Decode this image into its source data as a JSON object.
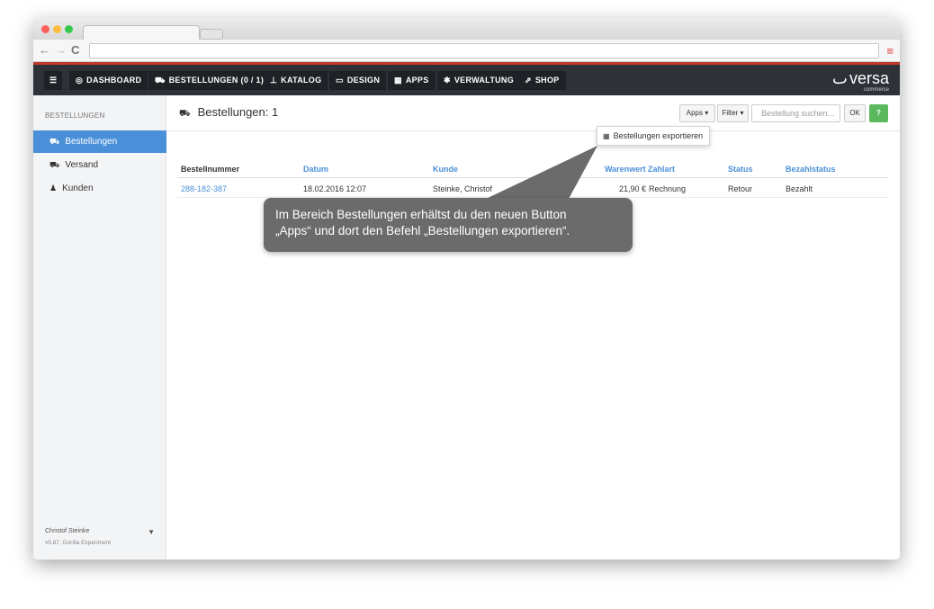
{
  "nav": {
    "items": [
      {
        "icon": "dashboard-icon",
        "label": "DASHBOARD"
      },
      {
        "icon": "cart-icon",
        "label": "BESTELLUNGEN (0 / 1)"
      },
      {
        "icon": "sitemap-icon",
        "label": "KATALOG"
      },
      {
        "icon": "monitor-icon",
        "label": "DESIGN"
      },
      {
        "icon": "grid-icon",
        "label": "APPS"
      },
      {
        "icon": "gear-icon",
        "label": "VERWALTUNG"
      },
      {
        "icon": "external-link-icon",
        "label": "SHOP"
      }
    ],
    "logo": {
      "text": "versa",
      "sub": "commerce"
    }
  },
  "sidebar": {
    "title": "BESTELLUNGEN",
    "items": [
      {
        "icon": "cart-icon",
        "label": "Bestellungen",
        "active": true
      },
      {
        "icon": "truck-icon",
        "label": "Versand",
        "active": false
      },
      {
        "icon": "user-icon",
        "label": "Kunden",
        "active": false
      }
    ],
    "user": "Christof Steinke",
    "version": "v5.87, Gorilla Experiment"
  },
  "main": {
    "title": "Bestellungen: 1",
    "apps_button": "Apps ▾",
    "filter_button": "Filter ▾",
    "search_placeholder": "Bestellung suchen...",
    "ok_button": "OK",
    "help_button": "?",
    "dropdown_item": "Bestellungen exportieren",
    "columns": [
      "Bestellnummer",
      "Datum",
      "Kunde",
      "Warenwert",
      "Zahlart",
      "Status",
      "Bezahlstatus"
    ],
    "rows": [
      [
        "288-182-387",
        "18.02.2016 12:07",
        "Steinke, Christof",
        "21,90 €",
        "Rechnung",
        "Retour",
        "Bezahlt"
      ]
    ]
  },
  "callout": {
    "line1": "Im Bereich Bestellungen erhältst du den neuen Button",
    "line2": "„Apps“ und dort den Befehl „Bestellungen exportieren“."
  },
  "colors": {
    "accent": "#4a90d9",
    "nav_bg": "#2e3238",
    "nav_stripe": "#c0392b",
    "success": "#5cb85c",
    "callout_bg": "#6b6b6b"
  }
}
